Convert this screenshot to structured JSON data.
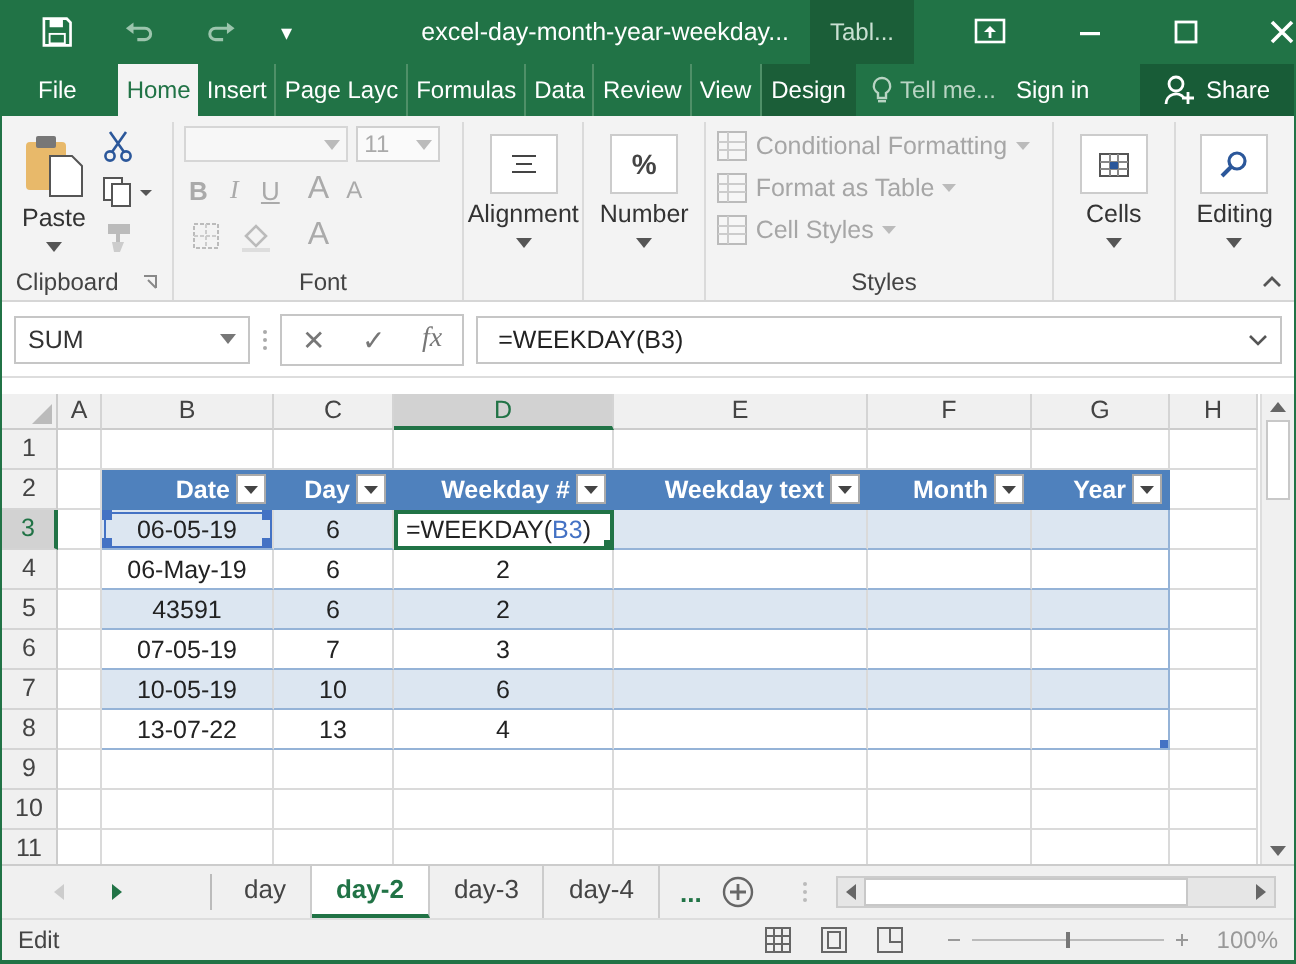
{
  "window": {
    "title": "excel-day-month-year-weekday...",
    "contextual_tab": "Tabl...",
    "quick_access_caret": "▾"
  },
  "ribbon_tabs": [
    {
      "label": "File",
      "selected": false,
      "kind": "file"
    },
    {
      "label": "Home",
      "selected": true,
      "kind": "tab"
    },
    {
      "label": "Insert",
      "selected": false,
      "kind": "tab"
    },
    {
      "label": "Page Layc",
      "selected": false,
      "kind": "tab"
    },
    {
      "label": "Formulas",
      "selected": false,
      "kind": "tab"
    },
    {
      "label": "Data",
      "selected": false,
      "kind": "tab"
    },
    {
      "label": "Review",
      "selected": false,
      "kind": "tab"
    },
    {
      "label": "View",
      "selected": false,
      "kind": "tab"
    },
    {
      "label": "Design",
      "selected": false,
      "kind": "contextual"
    }
  ],
  "tell_me": {
    "placeholder": "Tell me..."
  },
  "sign_in": "Sign in",
  "share": "Share",
  "ribbon": {
    "clipboard": {
      "paste": "Paste",
      "label": "Clipboard"
    },
    "font": {
      "disabled": true,
      "size": "11",
      "bold": "B",
      "italic": "I",
      "underline": "U",
      "grow": "A",
      "shrink": "A",
      "font_color": "A",
      "label": "Font"
    },
    "alignment": {
      "label": "Alignment"
    },
    "number": {
      "symbol": "%",
      "label": "Number"
    },
    "styles": {
      "items": [
        {
          "label": "Conditional Formatting",
          "disabled": true
        },
        {
          "label": "Format as Table",
          "disabled": true
        },
        {
          "label": "Cell Styles",
          "disabled": true
        }
      ],
      "label": "Styles"
    },
    "cells": {
      "label": "Cells"
    },
    "editing": {
      "label": "Editing"
    }
  },
  "formula_bar": {
    "name_box": "SUM",
    "cancel": "✕",
    "enter": "✓",
    "function": "fx",
    "formula": "=WEEKDAY(B3)"
  },
  "grid": {
    "columns": [
      {
        "label": "A",
        "selected": false
      },
      {
        "label": "B",
        "selected": false
      },
      {
        "label": "C",
        "selected": false
      },
      {
        "label": "D",
        "selected": true
      },
      {
        "label": "E",
        "selected": false
      },
      {
        "label": "F",
        "selected": false
      },
      {
        "label": "G",
        "selected": false
      },
      {
        "label": "H",
        "selected": false
      }
    ],
    "rows": [
      {
        "label": "1",
        "selected": false
      },
      {
        "label": "2",
        "selected": false
      },
      {
        "label": "3",
        "selected": true
      },
      {
        "label": "4",
        "selected": false
      },
      {
        "label": "5",
        "selected": false
      },
      {
        "label": "6",
        "selected": false
      },
      {
        "label": "7",
        "selected": false
      },
      {
        "label": "8",
        "selected": false
      },
      {
        "label": "9",
        "selected": false
      },
      {
        "label": "10",
        "selected": false
      },
      {
        "label": "11",
        "selected": false
      }
    ]
  },
  "table": {
    "headers": [
      "Date",
      "Day",
      "Weekday #",
      "Weekday text",
      "Month",
      "Year"
    ],
    "rows": [
      {
        "date": "06-05-19",
        "referenced": true,
        "day": "6",
        "formula": {
          "start": "=WEEKDAY(",
          "ref": "B3",
          "end": ")"
        }
      },
      {
        "date": "06-May-19",
        "referenced": false,
        "day": "6",
        "weekday": "2"
      },
      {
        "date": "43591",
        "referenced": false,
        "day": "6",
        "weekday": "2"
      },
      {
        "date": "07-05-19",
        "referenced": false,
        "day": "7",
        "weekday": "3"
      },
      {
        "date": "10-05-19",
        "referenced": false,
        "day": "10",
        "weekday": "6"
      },
      {
        "date": "13-07-22",
        "referenced": false,
        "day": "13",
        "weekday": "4"
      }
    ]
  },
  "sheet_tabs": [
    {
      "label": "day",
      "selected": false
    },
    {
      "label": "day-2",
      "selected": true
    },
    {
      "label": "day-3",
      "selected": false
    },
    {
      "label": "day-4",
      "selected": false
    }
  ],
  "more_sheets": "...",
  "status_bar": {
    "mode": "Edit",
    "zoom_slider": {
      "level": 0.5
    },
    "zoom": "100%"
  }
}
